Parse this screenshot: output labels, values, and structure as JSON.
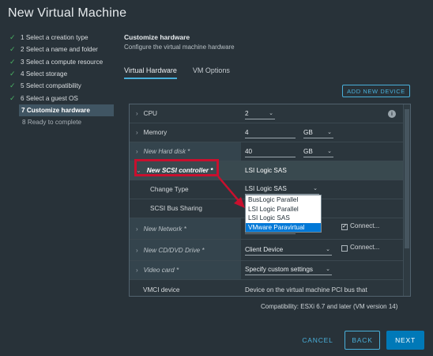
{
  "window": {
    "title": "New Virtual Machine"
  },
  "steps": [
    {
      "label": "1 Select a creation type",
      "state": "done"
    },
    {
      "label": "2 Select a name and folder",
      "state": "done"
    },
    {
      "label": "3 Select a compute resource",
      "state": "done"
    },
    {
      "label": "4 Select storage",
      "state": "done"
    },
    {
      "label": "5 Select compatibility",
      "state": "done"
    },
    {
      "label": "6 Select a guest OS",
      "state": "done"
    },
    {
      "label": "7 Customize hardware",
      "state": "active"
    },
    {
      "label": "8 Ready to complete",
      "state": "todo"
    }
  ],
  "section": {
    "title": "Customize hardware",
    "subtitle": "Configure the virtual machine hardware"
  },
  "tabs": [
    {
      "label": "Virtual Hardware",
      "active": true
    },
    {
      "label": "VM Options",
      "active": false
    }
  ],
  "add_device_label": "ADD NEW DEVICE",
  "hardware": {
    "cpu": {
      "label": "CPU",
      "value": "2"
    },
    "memory": {
      "label": "Memory",
      "value": "4",
      "unit": "GB"
    },
    "hard_disk": {
      "label": "New Hard disk *",
      "value": "40",
      "unit": "GB"
    },
    "scsi": {
      "label": "New SCSI controller *",
      "value": "LSI Logic SAS"
    },
    "change_type": {
      "label": "Change Type",
      "value": "LSI Logic SAS"
    },
    "bus_sharing": {
      "label": "SCSI Bus Sharing"
    },
    "network": {
      "label": "New Network *",
      "connect_label": "Connect...",
      "connected": true
    },
    "cd_dvd": {
      "label": "New CD/DVD Drive *",
      "value": "Client Device",
      "connect_label": "Connect...",
      "connected": false
    },
    "video": {
      "label": "Video card *",
      "value": "Specify custom settings"
    },
    "vmci": {
      "label": "VMCI device",
      "value": "Device on the virtual machine PCI bus that"
    }
  },
  "dropdown_options": [
    {
      "label": "BusLogic Parallel",
      "selected": false
    },
    {
      "label": "LSI Logic Parallel",
      "selected": false
    },
    {
      "label": "LSI Logic SAS",
      "selected": false
    },
    {
      "label": "VMware Paravirtual",
      "selected": true
    }
  ],
  "compatibility": "Compatibility: ESXi 6.7 and later (VM version 14)",
  "buttons": {
    "cancel": "CANCEL",
    "back": "BACK",
    "next": "NEXT"
  },
  "colors": {
    "accent": "#49afd9",
    "primary": "#0079b8",
    "highlight": "#c8102e",
    "check": "#4ab463"
  }
}
